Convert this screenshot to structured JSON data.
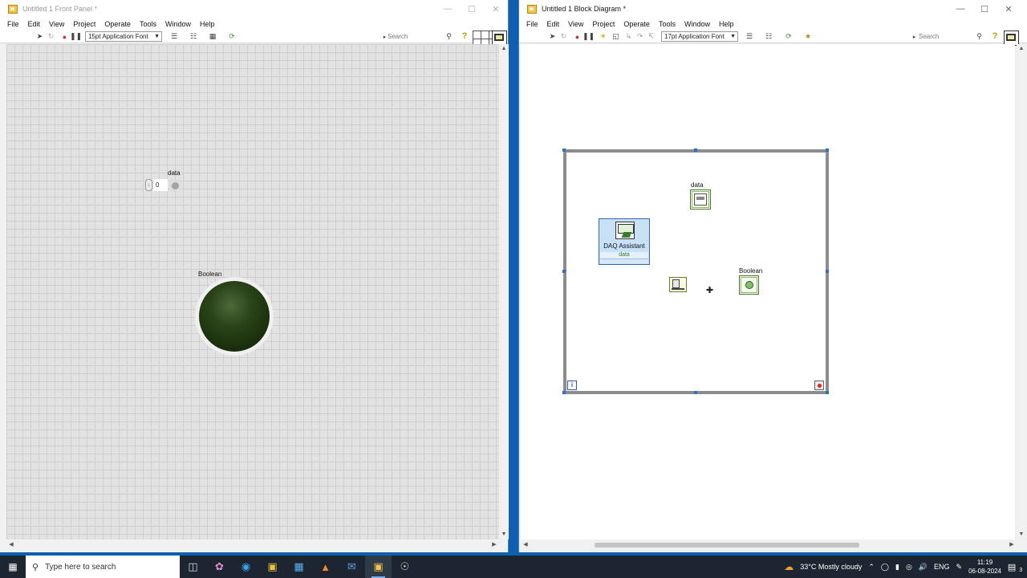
{
  "front_panel": {
    "title": "Untitled 1 Front Panel *",
    "menu": [
      "File",
      "Edit",
      "View",
      "Project",
      "Operate",
      "Tools",
      "Window",
      "Help"
    ],
    "font": "15pt Application Font",
    "search_placeholder": "Search",
    "numeric": {
      "label": "data",
      "value": "0"
    },
    "boolean": {
      "label": "Boolean"
    }
  },
  "block_diagram": {
    "title": "Untitled 1 Block Diagram *",
    "menu": [
      "File",
      "Edit",
      "View",
      "Project",
      "Operate",
      "Tools",
      "Window",
      "Help"
    ],
    "font": "17pt Application Font",
    "search_placeholder": "Search",
    "data_terminal": {
      "label": "data"
    },
    "boolean_terminal": {
      "label": "Boolean"
    },
    "daq": {
      "name": "DAQ Assistant",
      "output": "data"
    },
    "iteration_label": "i"
  },
  "taskbar": {
    "search_placeholder": "Type here to search",
    "weather": "33°C  Mostly cloudy",
    "language": "ENG",
    "time": "11:19",
    "date": "06-08-2024",
    "notifications": "3"
  }
}
